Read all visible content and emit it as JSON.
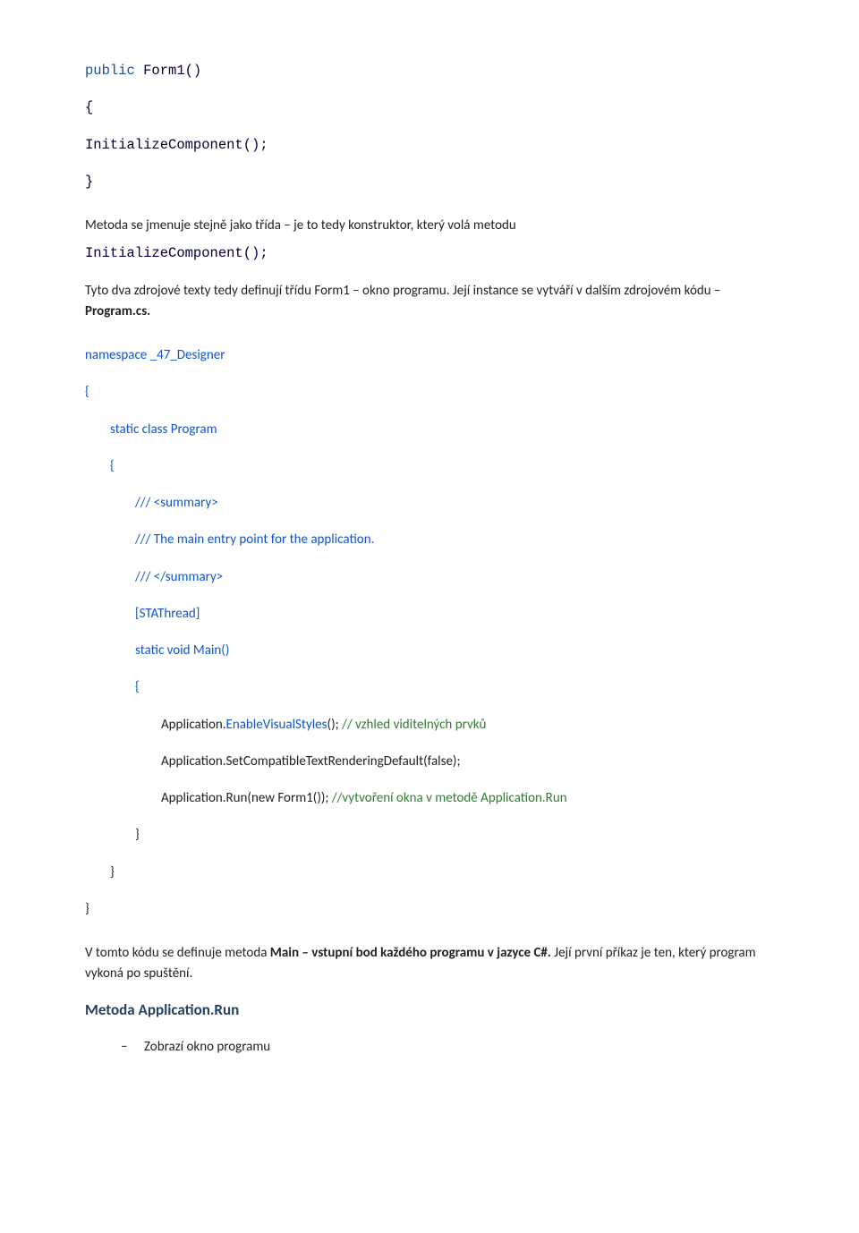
{
  "top_code": {
    "l1_kw": "public",
    "l1_rest": " Form1()",
    "l2": "{",
    "l3": "  InitializeComponent();",
    "l4": "}"
  },
  "para1_a": "Metoda se jmenuje stejně jako třída – je to tedy konstruktor, který volá metodu ",
  "para1_code": "InitializeComponent();",
  "para2_a": "Tyto dva zdrojové texty tedy definují třídu Form1 – okno programu. Její instance se vytváří v dalším zdrojovém kódu – ",
  "para2_b": "Program.cs.",
  "ns": {
    "l_ns": "namespace _47_Designer",
    "l_o1": "{",
    "l_static": "static class Program",
    "l_o2": "{",
    "l_sum1": "/// <summary>",
    "l_sum2": "/// The main entry point for the application.",
    "l_sum3": "/// </summary>",
    "l_attr": "[STAThread]",
    "l_main": "static void Main()",
    "l_o3": "{",
    "l_app1_a": "Application.",
    "l_app1_b": "EnableVisualStyles",
    "l_app1_c": "(); ",
    "l_app1_d": "// vzhled viditelných prvků",
    "l_app2": "Application.SetCompatibleTextRenderingDefault(false);",
    "l_app3_a": "Application.Run(new Form1());  ",
    "l_app3_b": "//vytvoření okna v metodě Application.Run",
    "l_c3": "}",
    "l_c2": "}",
    "l_c1": "}"
  },
  "para3_a": "V tomto kódu se definuje metoda ",
  "para3_b": "Main – vstupní bod každého programu v jazyce C#. ",
  "para3_c": "Její první příkaz je ten, který program vykoná po spuštění.",
  "heading": "Metoda Application.Run",
  "bullet_dash": "−",
  "bullet_text": "Zobrazí okno programu"
}
